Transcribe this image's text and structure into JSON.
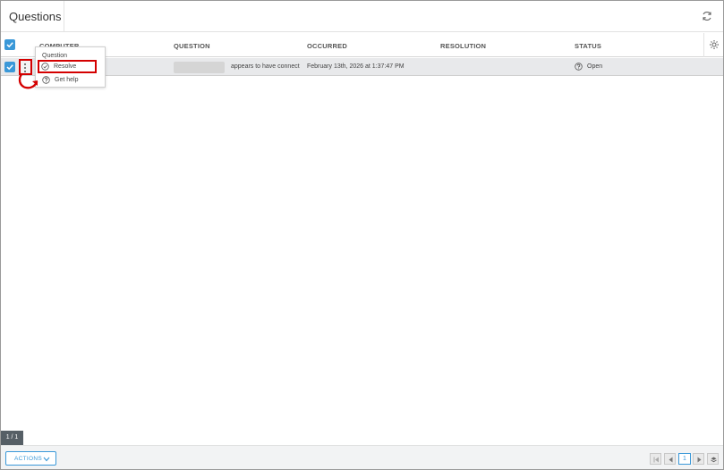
{
  "header": {
    "title": "Questions",
    "refresh_icon": "refresh-icon"
  },
  "table": {
    "columns": [
      "COMPUTER",
      "QUESTION",
      "OCCURRED",
      "RESOLUTION",
      "STATUS"
    ],
    "rows": [
      {
        "computer": "",
        "question": "appears to have connect",
        "occurred": "February 13th, 2026 at 1:37:47 PM",
        "resolution": "",
        "status": "Open",
        "checked": true
      }
    ]
  },
  "menu": {
    "title": "Question",
    "items": [
      {
        "label": "Resolve",
        "icon": "check-circle-icon"
      },
      {
        "label": "Get help",
        "icon": "question-circle-icon"
      }
    ]
  },
  "footer": {
    "page_badge": "1 / 1",
    "actions_label": "ACTIONS",
    "current_page": "1"
  },
  "colors": {
    "accent": "#3a98d8",
    "highlight": "#d40000",
    "row_bg": "#e8e9eb"
  }
}
